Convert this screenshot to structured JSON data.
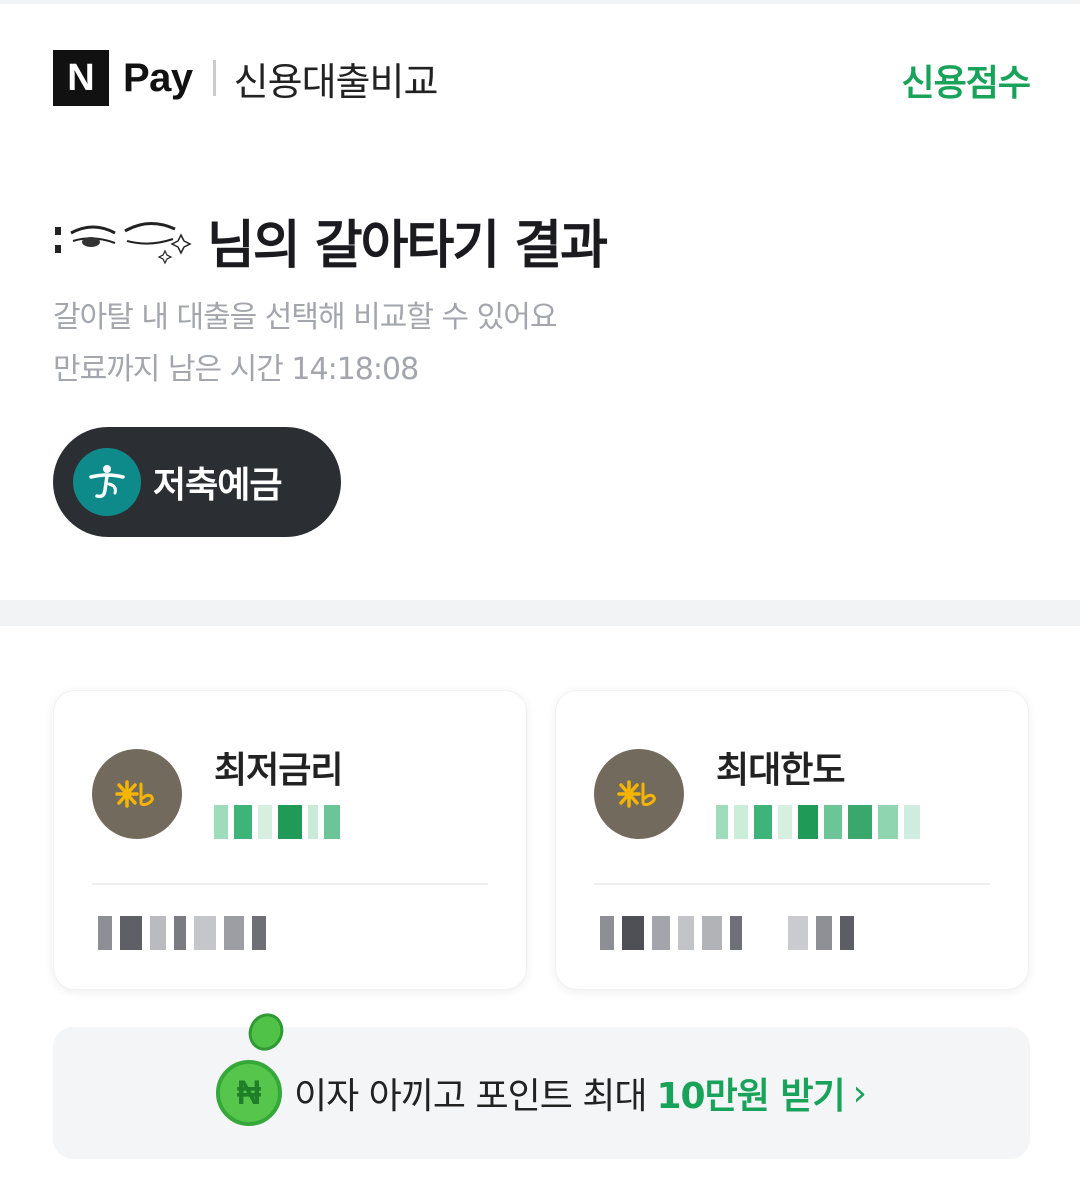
{
  "header": {
    "logo_letter": "N",
    "logo_text": "Pay",
    "service_title": "신용대출비교",
    "credit_score_link": "신용점수"
  },
  "main": {
    "title_suffix": "님의 갈아타기 결과",
    "subtitle": "갈아탈 내 대출을 선택해 비교할 수 있어요",
    "timer_label": "만료까지 남은 시간",
    "timer_value": "14:18:08",
    "selected_bank": "저축예금"
  },
  "cards": [
    {
      "title": "최저금리",
      "bank_icon": "kb-bank-logo"
    },
    {
      "title": "최대한도",
      "bank_icon": "kb-bank-logo"
    }
  ],
  "promo": {
    "text": "이자 아끼고 포인트 최대",
    "highlight": "10만원 받기",
    "chevron": "›"
  },
  "colors": {
    "accent_green": "#19a35a",
    "chip_background": "#2b2f34",
    "hana_teal": "#0f8a8a",
    "kb_brown": "#736a5e",
    "kb_yellow": "#f4b400"
  }
}
